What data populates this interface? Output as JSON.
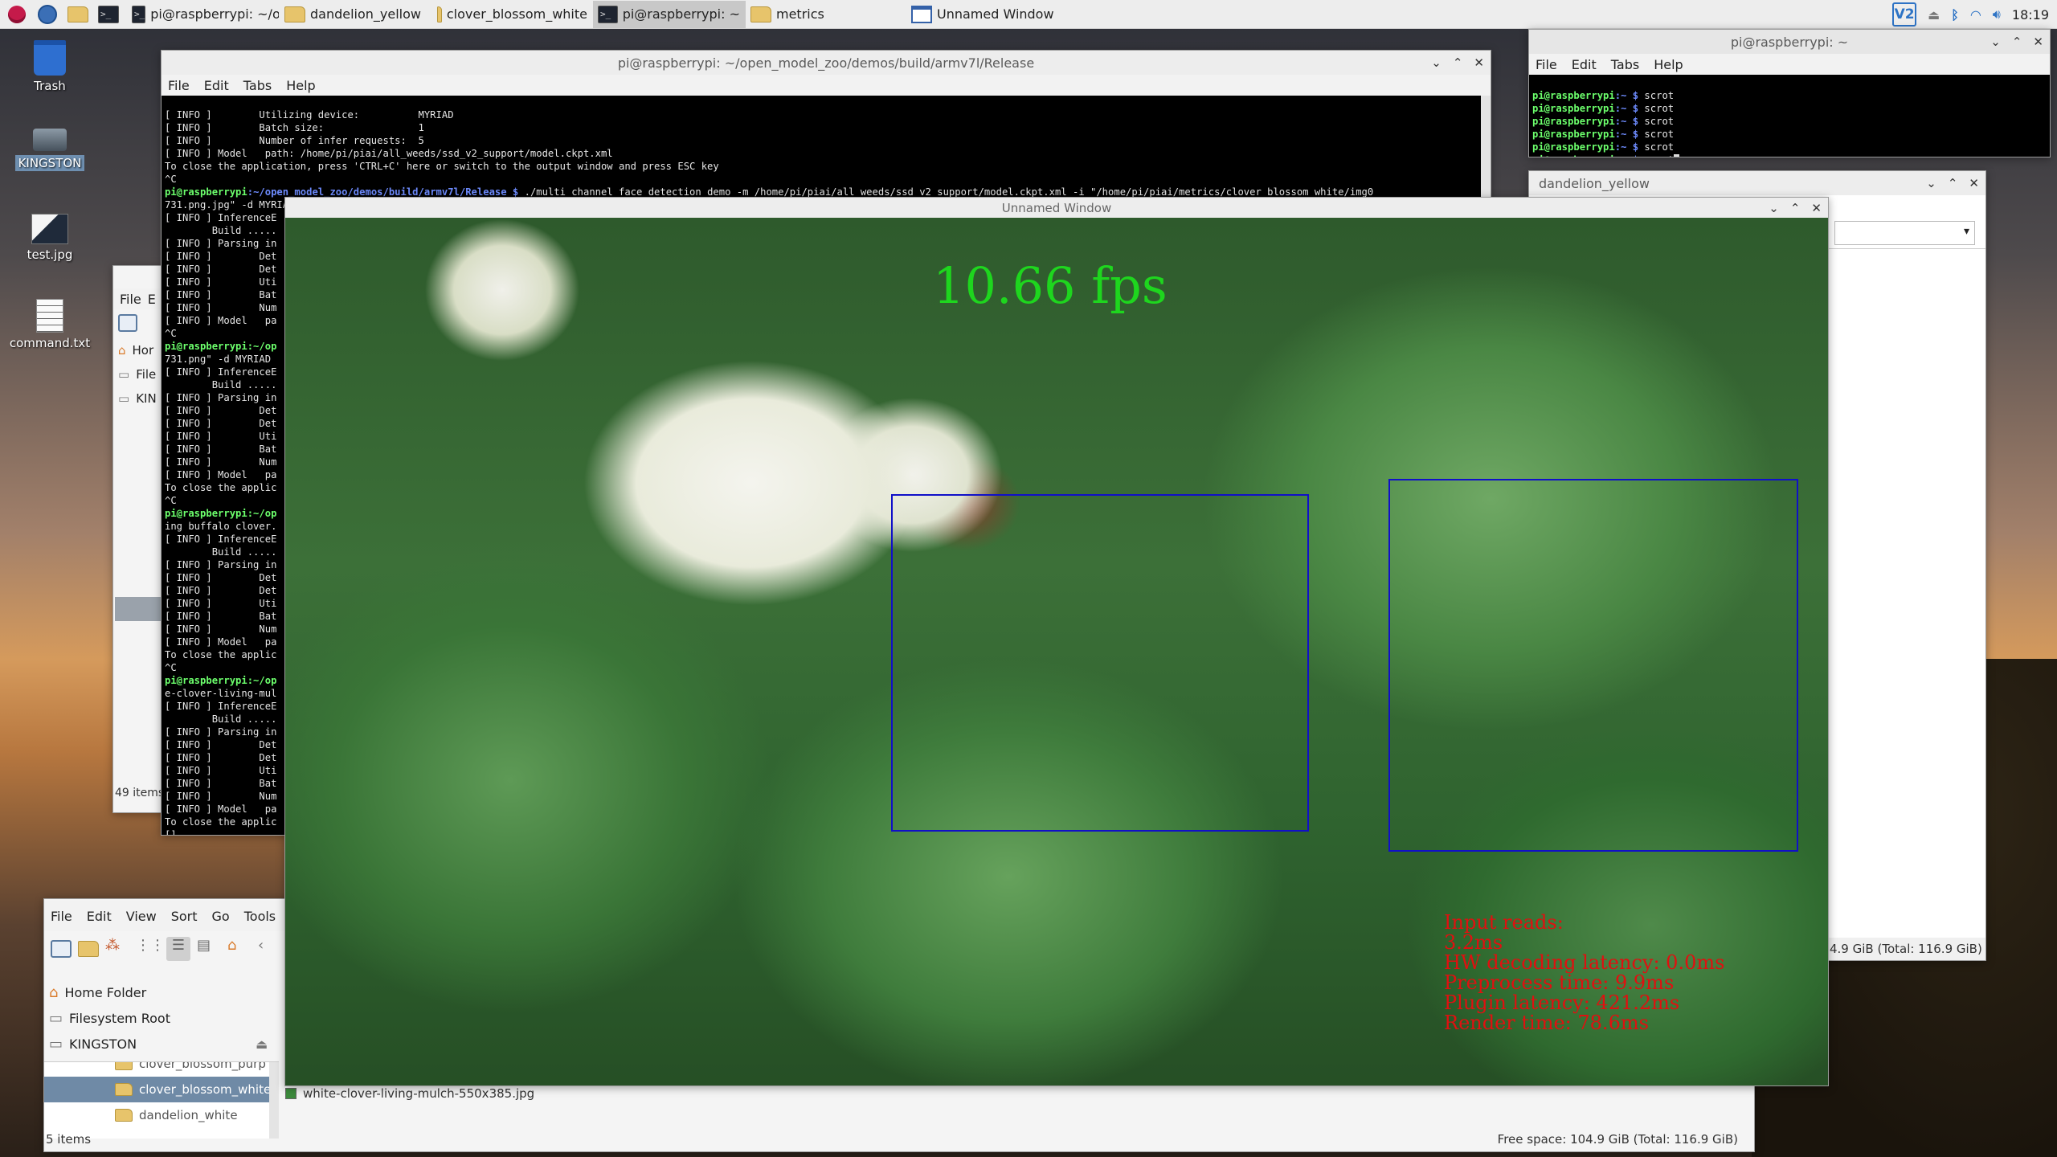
{
  "taskbar": {
    "tasks": [
      {
        "label": "pi@raspberrypi: ~/op...",
        "icon": "terminal-icon"
      },
      {
        "label": "dandelion_yellow",
        "icon": "folder-icon"
      },
      {
        "label": "clover_blossom_white",
        "icon": "folder-icon"
      },
      {
        "label": "pi@raspberrypi: ~",
        "icon": "terminal-icon"
      },
      {
        "label": "metrics",
        "icon": "folder-icon"
      },
      {
        "label": "Unnamed Window",
        "icon": "window-icon"
      }
    ],
    "tray_vnc": "V2",
    "clock": "18:19"
  },
  "desktop": {
    "icons": [
      {
        "label": "Trash"
      },
      {
        "label": "KINGSTON"
      },
      {
        "label": "test.jpg"
      },
      {
        "label": "command.txt"
      }
    ]
  },
  "terminal_main": {
    "title": "pi@raspberrypi: ~/open_model_zoo/demos/build/armv7l/Release",
    "menu": [
      "File",
      "Edit",
      "Tabs",
      "Help"
    ],
    "lines_top": [
      "[ INFO ]        Utilizing device:          MYRIAD",
      "[ INFO ]        Batch size:                1",
      "[ INFO ]        Number of infer requests:  5",
      "[ INFO ] Model   path: /home/pi/piai/all_weeds/ssd_v2_support/model.ckpt.xml",
      "To close the application, press 'CTRL+C' here or switch to the output window and press ESC key",
      "^C"
    ],
    "prompt_user": "pi@raspberrypi",
    "prompt_path": ":~/open_model_zoo/demos/build/armv7l/Release $",
    "command": " ./multi_channel_face_detection_demo -m /home/pi/piai/all_weeds/ssd_v2_support/model.ckpt.xml -i \"/home/pi/piai/metrics/clover_blossom_white/img0",
    "lines_left": [
      "731.png.jpg\" -d MYRIAD",
      "[ INFO ] InferenceE",
      "        Build .....",
      "[ INFO ] Parsing in",
      "[ INFO ]        Det",
      "[ INFO ]        Det",
      "[ INFO ]        Uti",
      "[ INFO ]        Bat",
      "[ INFO ]        Num",
      "[ INFO ] Model   pa",
      "^C",
      "pi@raspberrypi:~/op",
      "731.png\" -d MYRIAD",
      "[ INFO ] InferenceE",
      "        Build .....",
      "[ INFO ] Parsing in",
      "[ INFO ]        Det",
      "[ INFO ]        Det",
      "[ INFO ]        Uti",
      "[ INFO ]        Bat",
      "[ INFO ]        Num",
      "[ INFO ] Model   pa",
      "To close the applic",
      "^C",
      "pi@raspberrypi:~/op",
      "ing buffalo clover.",
      "[ INFO ] InferenceE",
      "        Build .....",
      "[ INFO ] Parsing in",
      "[ INFO ]        Det",
      "[ INFO ]        Det",
      "[ INFO ]        Uti",
      "[ INFO ]        Bat",
      "[ INFO ]        Num",
      "[ INFO ] Model   pa",
      "To close the applic",
      "^C",
      "pi@raspberrypi:~/op",
      "e-clover-living-mul",
      "[ INFO ] InferenceE",
      "        Build .....",
      "[ INFO ] Parsing in",
      "[ INFO ]        Det",
      "[ INFO ]        Det",
      "[ INFO ]        Uti",
      "[ INFO ]        Bat",
      "[ INFO ]        Num",
      "[ INFO ] Model   pa",
      "To close the applic",
      "[]"
    ]
  },
  "terminal_small": {
    "title": "pi@raspberrypi: ~",
    "menu": [
      "File",
      "Edit",
      "Tabs",
      "Help"
    ],
    "prompt_user": "pi@raspberrypi",
    "prompt_path": ":~ $",
    "commands": [
      " scrot",
      " scrot",
      " scrot",
      " scrot",
      " scrot",
      " scrot"
    ]
  },
  "fm_dandelion": {
    "title": "dandelion_yellow",
    "status": "4.9 GiB (Total: 116.9 GiB)"
  },
  "fm_hidden": {
    "menu": [
      "File",
      "E"
    ],
    "side": [
      "Hor",
      "File",
      "KIN"
    ],
    "status": "49 items"
  },
  "fm_bottom": {
    "menu": [
      "File",
      "Edit",
      "View",
      "Sort",
      "Go",
      "Tools"
    ],
    "places": [
      "Home Folder",
      "Filesystem Root",
      "KINGSTON"
    ],
    "tree": [
      "clover_blossom_purp",
      "clover_blossom_white",
      "dandelion_white"
    ],
    "status": "5 items",
    "selected_file": "white-clover-living-mulch-550x385.jpg",
    "free_space": "Free space: 104.9 GiB (Total: 116.9 GiB)"
  },
  "viewer": {
    "title": "Unnamed Window",
    "fps": "10.66 fps",
    "stats": [
      "Input reads:",
      "3.2ms",
      "HW decoding latency: 0.0ms",
      "Preprocess time: 9.9ms",
      "Plugin latency: 421.2ms",
      "Render time: 78.6ms"
    ]
  },
  "colors": {
    "bbox": "#1010c8",
    "fps_text": "#1ed61e",
    "stats_text": "#e01010",
    "prompt_user": "#6cff6c",
    "prompt_path": "#6e8cff"
  }
}
